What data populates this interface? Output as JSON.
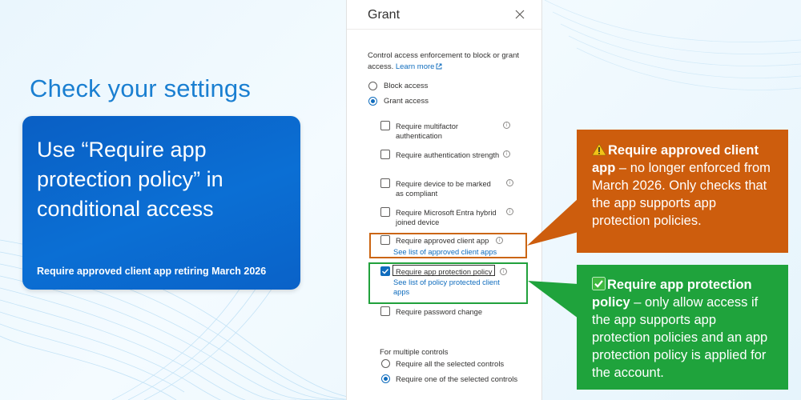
{
  "slide": {
    "title": "Check your settings",
    "card_headline": "Use “Require app protection policy” in conditional access",
    "card_footer": "Require approved client app retiring March 2026"
  },
  "panel": {
    "title": "Grant",
    "description": "Control access enforcement to block or grant access.",
    "learn_more": "Learn more",
    "radios": [
      {
        "label": "Block access",
        "checked": false
      },
      {
        "label": "Grant access",
        "checked": true
      }
    ],
    "controls": [
      {
        "label": "Require multifactor authentication",
        "checked": false
      },
      {
        "label": "Require authentication strength",
        "checked": false
      },
      {
        "label": "Require device to be marked as compliant",
        "checked": false
      },
      {
        "label": "Require Microsoft Entra hybrid joined device",
        "checked": false
      },
      {
        "label": "Require approved client app",
        "checked": false,
        "link": "See list of approved client apps"
      },
      {
        "label": "Require app protection policy",
        "checked": true,
        "link": "See list of policy protected client apps"
      },
      {
        "label": "Require password change",
        "checked": false
      }
    ],
    "multiple_controls_label": "For multiple controls",
    "multi_radios": [
      {
        "label": "Require all the selected controls",
        "checked": false
      },
      {
        "label": "Require one of the selected controls",
        "checked": true
      }
    ]
  },
  "callouts": {
    "orange": {
      "icon": "warning-icon",
      "bold": "Require approved client app",
      "text": " – no longer enforced from March 2026. Only checks that the app supports app protection policies."
    },
    "green": {
      "icon": "check-mark-icon",
      "bold": "Require app protection policy",
      "text": " – only allow access if the app supports app protection policies and an app protection policy is applied for the account."
    }
  },
  "colors": {
    "title_blue": "#1a7fd1",
    "card_blue": "#0b6fd4",
    "callout_orange": "#cd5d0d",
    "callout_green": "#1fa33c",
    "link_blue": "#0f6cbd"
  }
}
